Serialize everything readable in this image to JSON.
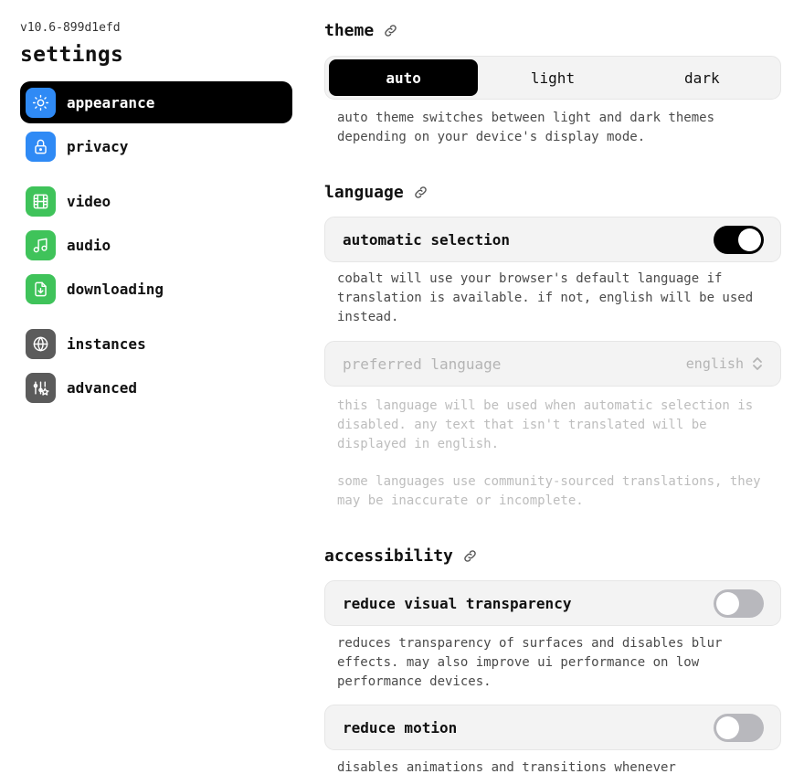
{
  "sidebar": {
    "version": "v10.6-899d1efd",
    "title": "settings",
    "items": [
      {
        "label": "appearance",
        "icon": "sun-icon"
      },
      {
        "label": "privacy",
        "icon": "lock-icon"
      },
      {
        "label": "video",
        "icon": "film-icon"
      },
      {
        "label": "audio",
        "icon": "music-note-icon"
      },
      {
        "label": "downloading",
        "icon": "download-file-icon"
      },
      {
        "label": "instances",
        "icon": "globe-icon"
      },
      {
        "label": "advanced",
        "icon": "sliders-icon"
      }
    ]
  },
  "theme": {
    "title": "theme",
    "options": [
      "auto",
      "light",
      "dark"
    ],
    "selected": "auto",
    "description": "auto theme switches between light and dark themes depending on your device's display mode."
  },
  "language": {
    "title": "language",
    "auto_label": "automatic selection",
    "auto_enabled": true,
    "auto_description": "cobalt will use your browser's default language if translation is available. if not, english will be used instead.",
    "preferred_label": "preferred language",
    "preferred_value": "english",
    "preferred_description": "this language will be used when automatic selection is disabled. any text that isn't translated will be displayed in english.",
    "community_note": "some languages use community-sourced translations, they may be inaccurate or incomplete."
  },
  "accessibility": {
    "title": "accessibility",
    "transparency_label": "reduce visual transparency",
    "transparency_enabled": false,
    "transparency_description": "reduces transparency of surfaces and disables blur effects. may also improve ui performance on low performance devices.",
    "motion_label": "reduce motion",
    "motion_enabled": false,
    "motion_description": "disables animations and transitions whenever"
  },
  "colors": {
    "blue": "#2f8af5",
    "green": "#3fc35a",
    "gray": "#5b5b5b",
    "active": "#000000"
  }
}
